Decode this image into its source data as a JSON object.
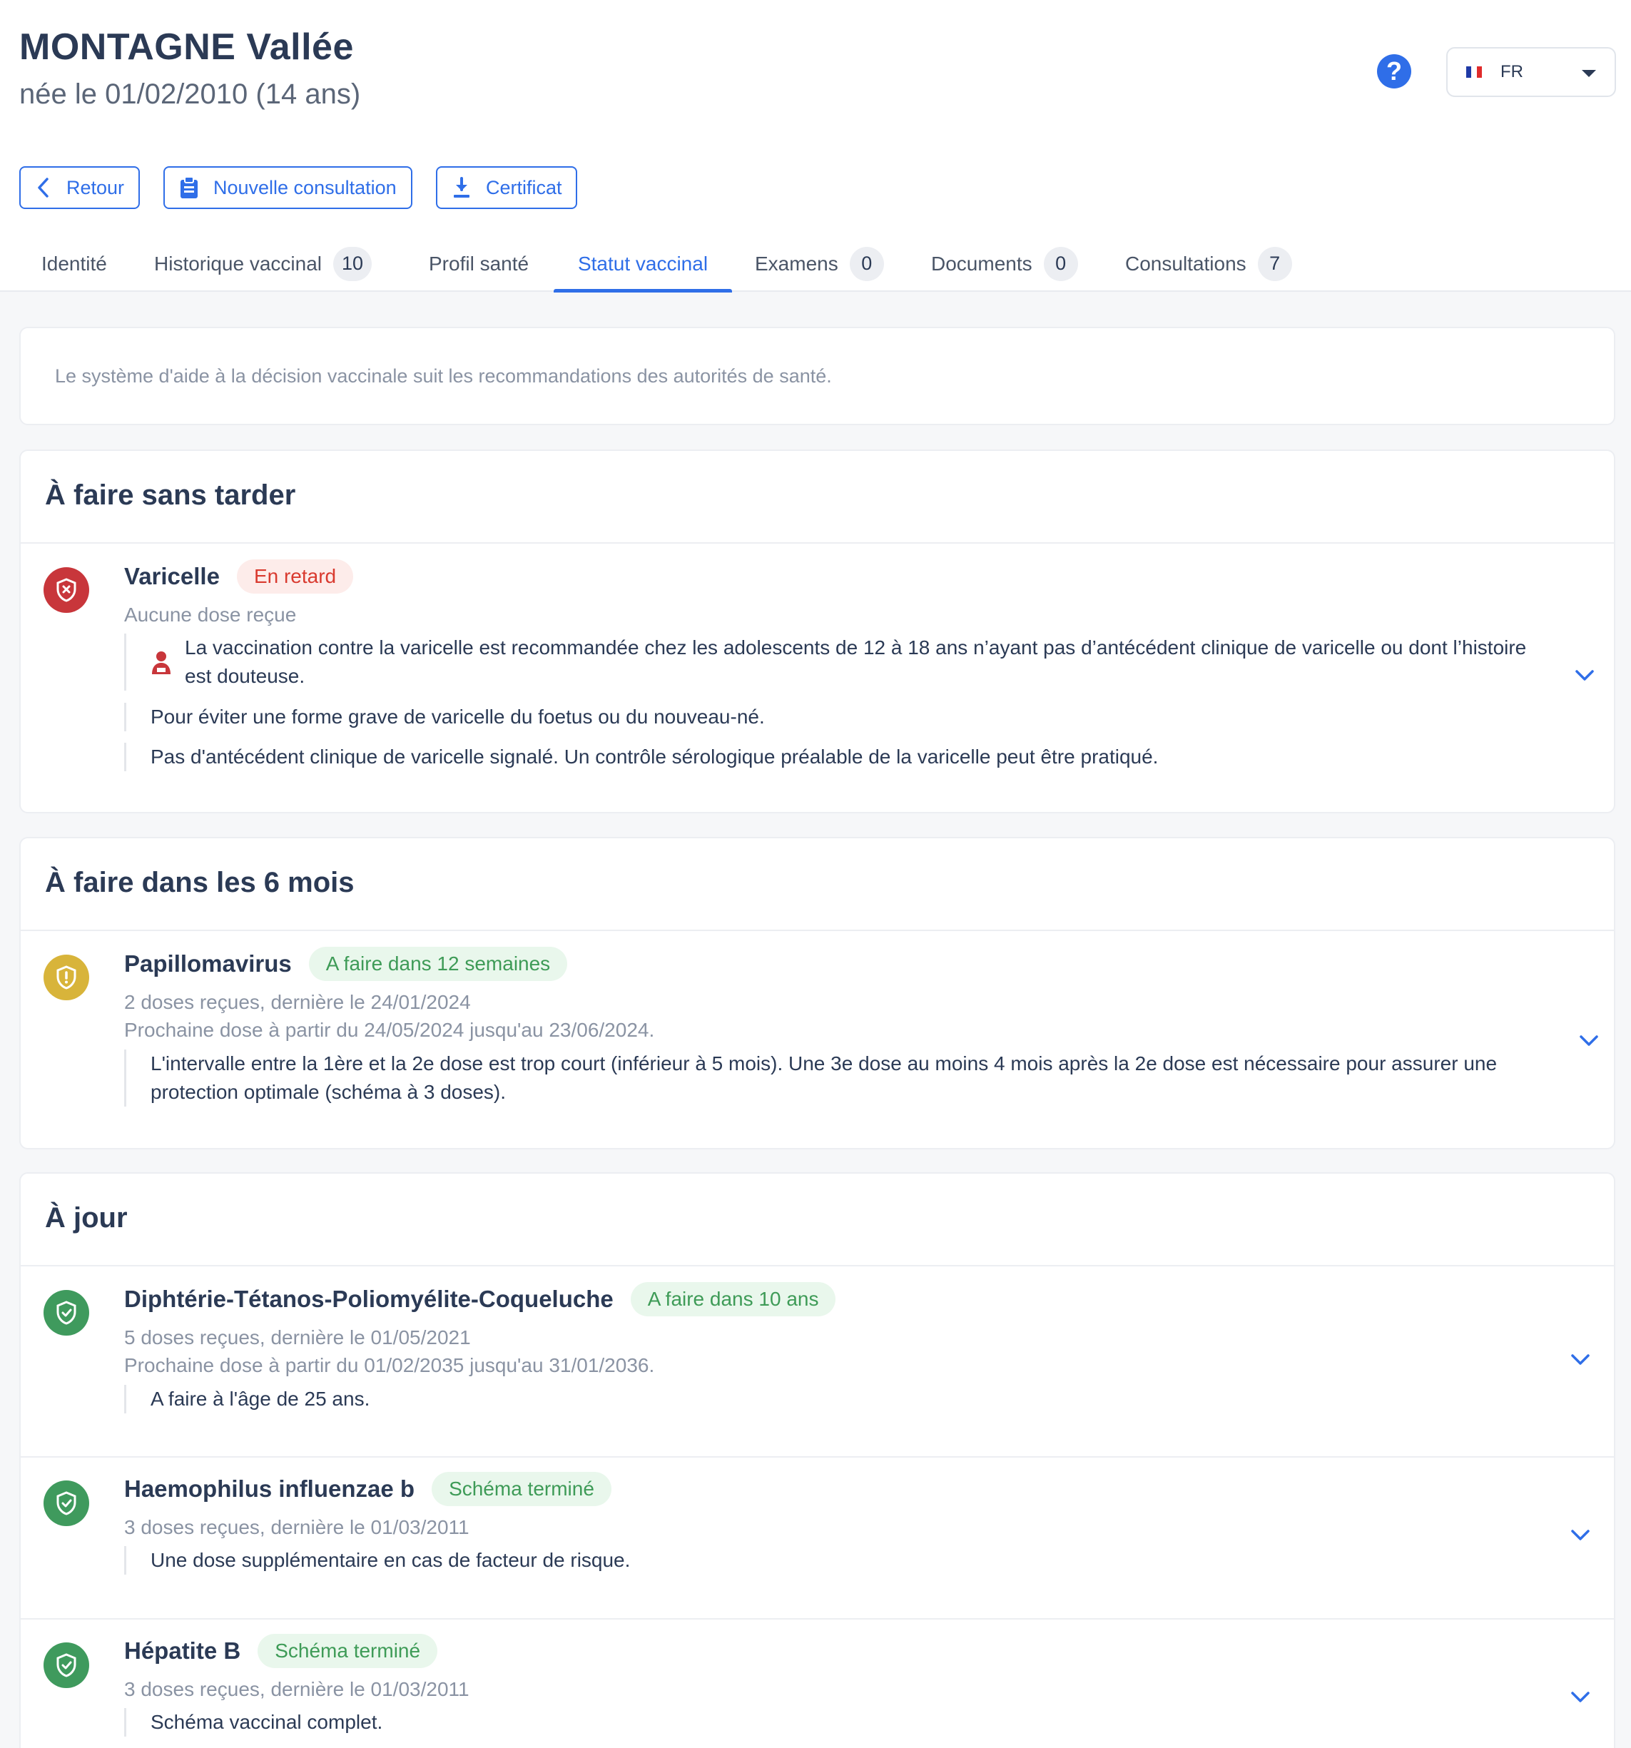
{
  "patient": {
    "name": "MONTAGNE Vallée",
    "birth": "née le 01/02/2010 (14 ans)"
  },
  "header": {
    "help_label": "?",
    "language": "FR"
  },
  "colors": {
    "accent": "#2f6ee8",
    "danger": "#c8363b",
    "warning": "#d8b43a",
    "success": "#3f9a5d"
  },
  "actions": {
    "back": "Retour",
    "new_consultation": "Nouvelle consultation",
    "certificate": "Certificat"
  },
  "tabs": [
    {
      "label": "Identité"
    },
    {
      "label": "Historique vaccinal",
      "count": "10"
    },
    {
      "label": "Profil santé"
    },
    {
      "label": "Statut vaccinal",
      "active": true
    },
    {
      "label": "Examens",
      "count": "0"
    },
    {
      "label": "Documents",
      "count": "0"
    },
    {
      "label": "Consultations",
      "count": "7"
    }
  ],
  "info": "Le système d'aide à la décision vaccinale suit les recommandations des autorités de santé.",
  "sections": {
    "urgent": {
      "title": "À faire sans tarder",
      "items": [
        {
          "icon": "shield-x-icon",
          "name": "Varicelle",
          "status": "En retard",
          "doses": "Aucune dose reçue",
          "notes": [
            "La vaccination contre la varicelle est recommandée chez les adolescents de 12 à 18 ans n’ayant pas d’antécédent clinique de varicelle ou dont l’histoire est douteuse.",
            "Pour éviter une forme grave de varicelle du foetus ou du nouveau-né.",
            "Pas d'antécédent clinique de varicelle signalé. Un contrôle sérologique préalable de la varicelle peut être pratiqué."
          ]
        }
      ]
    },
    "six_months": {
      "title": "À faire dans les 6 mois",
      "items": [
        {
          "icon": "shield-alert-icon",
          "name": "Papillomavirus",
          "status": "A faire dans 12 semaines",
          "doses": "2 doses reçues, dernière le 24/01/2024",
          "next": "Prochaine dose à partir du 24/05/2024 jusqu'au 23/06/2024.",
          "notes": [
            "L'intervalle entre la 1ère et la 2e dose est trop court (inférieur à 5 mois). Une 3e dose au moins 4 mois après la 2e dose est nécessaire pour assurer une protection optimale (schéma à 3 doses)."
          ]
        }
      ]
    },
    "up_to_date": {
      "title": "À jour",
      "items": [
        {
          "icon": "shield-check-icon",
          "name": "Diphtérie-Tétanos-Poliomyélite-Coqueluche",
          "status": "A faire dans 10 ans",
          "doses": "5 doses reçues, dernière le 01/05/2021",
          "next": "Prochaine dose à partir du 01/02/2035 jusqu'au 31/01/2036.",
          "notes": [
            "A faire à l'âge de 25 ans."
          ]
        },
        {
          "icon": "shield-check-icon",
          "name": "Haemophilus influenzae b",
          "status": "Schéma terminé",
          "doses": "3 doses reçues, dernière le 01/03/2011",
          "notes": [
            "Une dose supplémentaire en cas de facteur de risque."
          ]
        },
        {
          "icon": "shield-check-icon",
          "name": "Hépatite B",
          "status": "Schéma terminé",
          "doses": "3 doses reçues, dernière le 01/03/2011",
          "notes": [
            "Schéma vaccinal complet."
          ]
        }
      ]
    }
  }
}
